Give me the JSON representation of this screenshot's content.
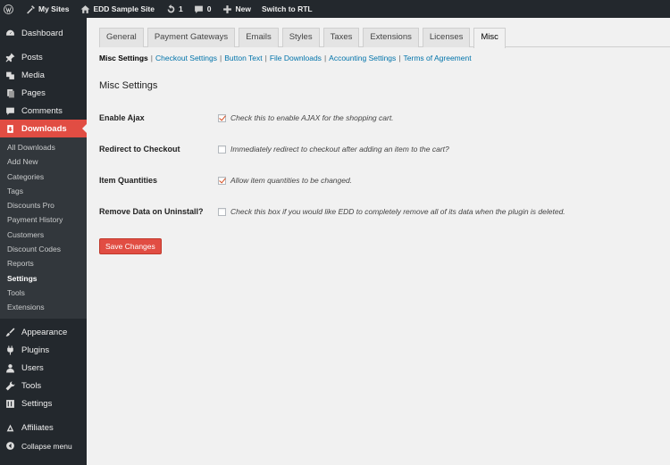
{
  "admin_bar": {
    "my_sites": "My Sites",
    "site_name": "EDD Sample Site",
    "updates_count": "1",
    "comments_count": "0",
    "new_label": "New",
    "rtl_label": "Switch to RTL"
  },
  "sidebar": {
    "dashboard": "Dashboard",
    "posts": "Posts",
    "media": "Media",
    "pages": "Pages",
    "comments": "Comments",
    "downloads": "Downloads",
    "downloads_submenu": [
      "All Downloads",
      "Add New",
      "Categories",
      "Tags",
      "Discounts Pro",
      "Payment History",
      "Customers",
      "Discount Codes",
      "Reports",
      "Settings",
      "Tools",
      "Extensions"
    ],
    "appearance": "Appearance",
    "plugins": "Plugins",
    "users": "Users",
    "tools": "Tools",
    "settings": "Settings",
    "affiliates": "Affiliates",
    "collapse": "Collapse menu"
  },
  "tabs": [
    "General",
    "Payment Gateways",
    "Emails",
    "Styles",
    "Taxes",
    "Extensions",
    "Licenses",
    "Misc"
  ],
  "active_tab": "Misc",
  "sub_sections": [
    "Misc Settings",
    "Checkout Settings",
    "Button Text",
    "File Downloads",
    "Accounting Settings",
    "Terms of Agreement"
  ],
  "section_title": "Misc Settings",
  "options": [
    {
      "label": "Enable Ajax",
      "checked": true,
      "description": "Check this to enable AJAX for the shopping cart."
    },
    {
      "label": "Redirect to Checkout",
      "checked": false,
      "description": "Immediately redirect to checkout after adding an item to the cart?"
    },
    {
      "label": "Item Quantities",
      "checked": true,
      "description": "Allow item quantities to be changed."
    },
    {
      "label": "Remove Data on Uninstall?",
      "checked": false,
      "description": "Check this box if you would like EDD to completely remove all of its data when the plugin is deleted."
    }
  ],
  "save_label": "Save Changes",
  "colors": {
    "accent": "#e14d43",
    "sidebar_bg": "#23282d",
    "link": "#0073aa"
  }
}
